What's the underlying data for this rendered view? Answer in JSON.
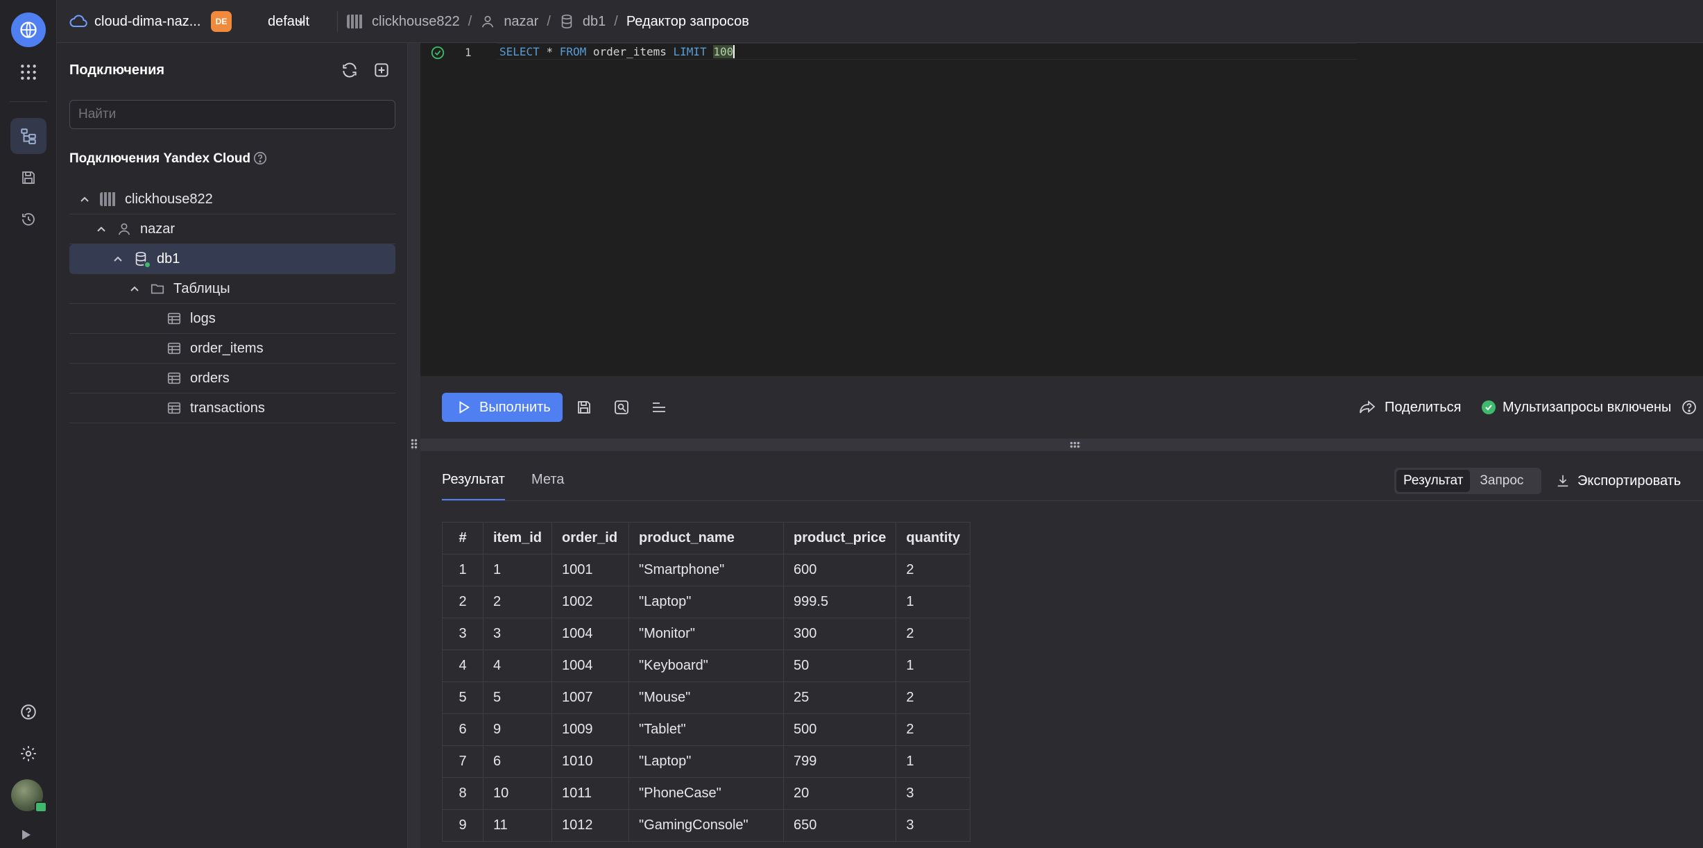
{
  "topbar": {
    "cloud_name": "cloud-dima-naz...",
    "folder_badge": "DE",
    "folder_name": "default",
    "breadcrumbs": [
      "clickhouse822",
      "nazar",
      "db1",
      "Редактор запросов"
    ]
  },
  "sidebar": {
    "title": "Подключения",
    "search_placeholder": "Найти",
    "section_title": "Подключения Yandex Cloud",
    "tree": {
      "cluster": "clickhouse822",
      "user": "nazar",
      "database": "db1",
      "folder": "Таблицы",
      "tables": [
        "logs",
        "order_items",
        "orders",
        "transactions"
      ]
    }
  },
  "editor": {
    "line_number": "1",
    "kw_select": "SELECT",
    "star": "*",
    "kw_from": "FROM",
    "table": "order_items",
    "kw_limit": "LIMIT",
    "limit_value": "100"
  },
  "toolbar": {
    "run_label": "Выполнить",
    "share_label": "Поделиться",
    "multi_label": "Мультизапросы включены"
  },
  "results": {
    "tabs": [
      "Результат",
      "Мета"
    ],
    "view_toggle": [
      "Результат",
      "Запрос"
    ],
    "export_label": "Экспортировать",
    "columns": [
      "#",
      "item_id",
      "order_id",
      "product_name",
      "product_price",
      "quantity"
    ],
    "rows": [
      [
        "1",
        "1",
        "1001",
        "\"Smartphone\"",
        "600",
        "2"
      ],
      [
        "2",
        "2",
        "1002",
        "\"Laptop\"",
        "999.5",
        "1"
      ],
      [
        "3",
        "3",
        "1004",
        "\"Monitor\"",
        "300",
        "2"
      ],
      [
        "4",
        "4",
        "1004",
        "\"Keyboard\"",
        "50",
        "1"
      ],
      [
        "5",
        "5",
        "1007",
        "\"Mouse\"",
        "25",
        "2"
      ],
      [
        "6",
        "9",
        "1009",
        "\"Tablet\"",
        "500",
        "2"
      ],
      [
        "7",
        "6",
        "1010",
        "\"Laptop\"",
        "799",
        "1"
      ],
      [
        "8",
        "10",
        "1011",
        "\"PhoneCase\"",
        "20",
        "3"
      ],
      [
        "9",
        "11",
        "1012",
        "\"GamingConsole\"",
        "650",
        "3"
      ]
    ]
  },
  "colors": {
    "accent": "#4f7ff0",
    "success": "#3fb96b",
    "keyword": "#569cd6",
    "badge": "#f08a3c"
  }
}
